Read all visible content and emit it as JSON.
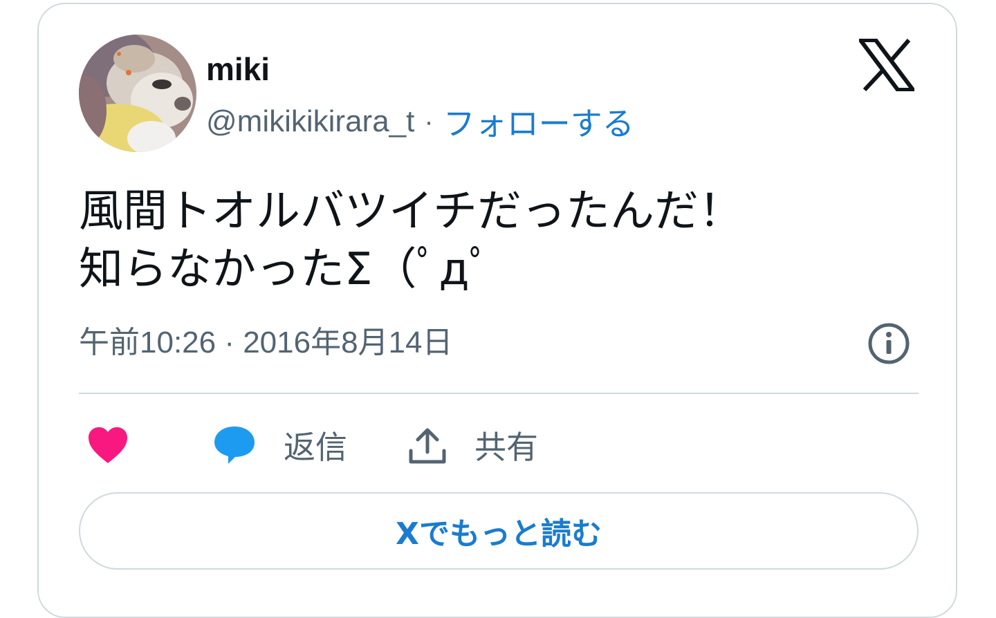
{
  "user": {
    "name": "miki",
    "handle": "@mikikikirara_t",
    "separator": "·",
    "follow_label": "フォローする"
  },
  "tweet": {
    "line1": "風間トオルバツイチだったんだ！",
    "line2": "知らなかったΣ（ﾟдﾟ",
    "timestamp": "午前10:26 · 2016年8月14日"
  },
  "actions": {
    "reply_label": "返信",
    "share_label": "共有"
  },
  "readmore_label": "Xでもっと読む",
  "colors": {
    "link_blue": "#1a7ccf",
    "like_pink": "#f91880",
    "reply_blue": "#1d9bf0",
    "muted_gray": "#536471",
    "border": "#cfd9de"
  },
  "icons": {
    "brand": "x-logo-icon",
    "info": "info-icon",
    "like": "heart-icon",
    "reply": "speech-bubble-icon",
    "share": "share-upload-icon"
  }
}
